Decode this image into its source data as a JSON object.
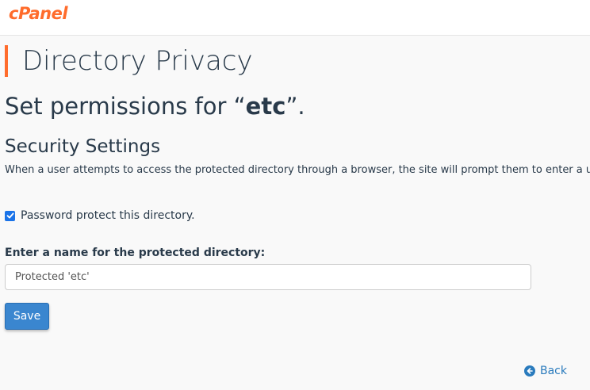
{
  "brand": {
    "logo_text": "cPanel",
    "accent_color": "#ff6c2c"
  },
  "page": {
    "title": "Directory Privacy",
    "heading_prefix": "Set permissions for “",
    "directory_name": "etc",
    "heading_suffix": "”."
  },
  "security": {
    "title": "Security Settings",
    "description": "When a user attempts to access the protected directory through a browser, the site will prompt them to enter a us",
    "protect_checkbox": {
      "label": "Password protect this directory.",
      "checked": true
    },
    "name_field": {
      "label": "Enter a name for the protected directory:",
      "value": "Protected 'etc'"
    },
    "save_label": "Save"
  },
  "navigation": {
    "back_label": "Back",
    "back_icon": "arrow-circle-left-icon",
    "link_color": "#2a7bbd"
  }
}
